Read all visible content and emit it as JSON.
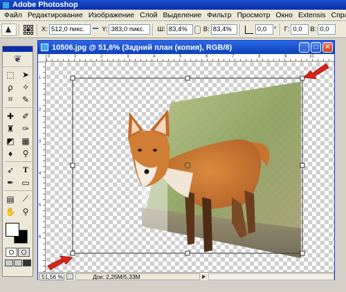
{
  "app": {
    "title": "Adobe Photoshop"
  },
  "menu": [
    "Файл",
    "Редактирование",
    "Изображение",
    "Слой",
    "Выделение",
    "Фильтр",
    "Просмотр",
    "Окно",
    "Extensis",
    "Справка"
  ],
  "options": {
    "x_label": "X:",
    "x_value": "512,0 пикс.",
    "y_label": "Y:",
    "y_value": "383,0 пикс.",
    "w_label": "Ш:",
    "w_value": "83,4%",
    "h_label": "В:",
    "h_value": "83,4%",
    "angle_value": "0,0",
    "hskew_label": "Г:",
    "hskew_value": "0,0",
    "vskew_label": "В:",
    "vskew_value": "0,0"
  },
  "document": {
    "title": "10506.jpg @ 51,6% (Задний план (копия), RGB/8)",
    "status_zoom": "51,56 %",
    "status_info": "Док: 2,25M/5,33M",
    "ruler_h_labels": [
      "0",
      "1",
      "2",
      "3",
      "4",
      "5",
      "6",
      "7",
      "8",
      "9",
      "10"
    ],
    "ruler_v_labels": [
      "1",
      "2",
      "3",
      "4",
      "5",
      "6"
    ]
  },
  "colors": {
    "app_title": "#0a2ea8",
    "arrow": "#d8231a",
    "transform_frame": "#333333",
    "checker": "#cfcfcf"
  },
  "icons": {
    "tools": [
      "marquee-icon",
      "move-icon",
      "lasso-icon",
      "magic-wand-icon",
      "crop-icon",
      "slice-icon",
      "healing-icon",
      "brush-icon",
      "stamp-icon",
      "history-brush-icon",
      "eraser-icon",
      "gradient-icon",
      "blur-icon",
      "dodge-icon",
      "path-select-icon",
      "type-icon",
      "pen-icon",
      "shape-icon",
      "notes-icon",
      "eyedropper-icon",
      "hand-icon",
      "zoom-icon"
    ]
  }
}
